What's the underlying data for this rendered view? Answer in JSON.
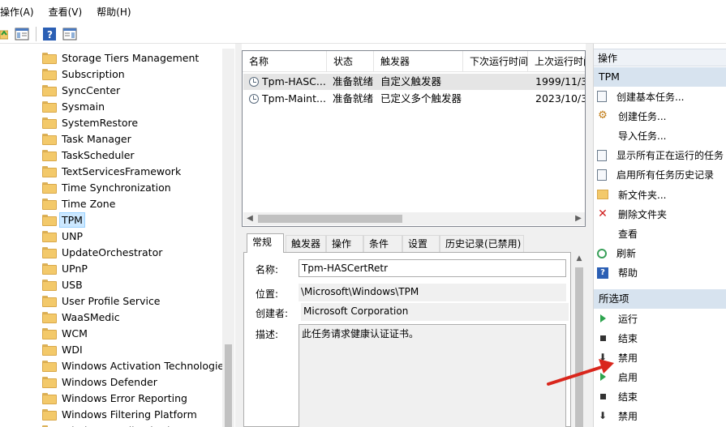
{
  "menu": [
    "操作(A)",
    "查看(V)",
    "帮助(H)"
  ],
  "toolbar": {
    "buttons": [
      "folder-up-icon",
      "show-hide-tree-icon",
      "help-icon",
      "action-pane-icon"
    ]
  },
  "tree": {
    "items": [
      "Storage Tiers Management",
      "Subscription",
      "SyncCenter",
      "Sysmain",
      "SystemRestore",
      "Task Manager",
      "TaskScheduler",
      "TextServicesFramework",
      "Time Synchronization",
      "Time Zone",
      "TPM",
      "UNP",
      "UpdateOrchestrator",
      "UPnP",
      "USB",
      "User Profile Service",
      "WaaSMedic",
      "WCM",
      "WDI",
      "Windows Activation Technologies",
      "Windows Defender",
      "Windows Error Reporting",
      "Windows Filtering Platform",
      "Windows Media Sharing"
    ],
    "selected": "TPM"
  },
  "tasklist": {
    "columns": [
      "名称",
      "状态",
      "触发器",
      "下次运行时间",
      "上次运行时间"
    ],
    "rows": [
      {
        "name": "Tpm-HASC...",
        "status": "准备就绪",
        "trigger": "自定义触发器",
        "next": "",
        "last": "1999/11/3"
      },
      {
        "name": "Tpm-Maint...",
        "status": "准备就绪",
        "trigger": "已定义多个触发器",
        "next": "",
        "last": "2023/10/3"
      }
    ]
  },
  "detail": {
    "tabs": [
      "常规",
      "触发器",
      "操作",
      "条件",
      "设置",
      "历史记录(已禁用)"
    ],
    "fields": {
      "name_label": "名称:",
      "name_value": "Tpm-HASCertRetr",
      "location_label": "位置:",
      "location_value": "\\Microsoft\\Windows\\TPM",
      "author_label": "创建者:",
      "author_value": "Microsoft Corporation",
      "desc_label": "描述:",
      "desc_value": "此任务请求健康认证证书。"
    }
  },
  "actions": {
    "header": "操作",
    "group1_title": "TPM",
    "group1": [
      {
        "label": "创建基本任务...",
        "icon": "create-basic-task-icon"
      },
      {
        "label": "创建任务...",
        "icon": "create-task-icon"
      },
      {
        "label": "导入任务...",
        "icon": "none"
      },
      {
        "label": "显示所有正在运行的任务",
        "icon": "running-tasks-icon"
      },
      {
        "label": "启用所有任务历史记录",
        "icon": "history-icon"
      },
      {
        "label": "新文件夹...",
        "icon": "new-folder-icon"
      },
      {
        "label": "删除文件夹",
        "icon": "delete-icon"
      },
      {
        "label": "查看",
        "icon": "none"
      },
      {
        "label": "刷新",
        "icon": "refresh-icon"
      },
      {
        "label": "帮助",
        "icon": "help-icon"
      }
    ],
    "group2_title": "所选项",
    "group2": [
      {
        "label": "运行",
        "icon": "run-icon"
      },
      {
        "label": "结束",
        "icon": "end-icon"
      },
      {
        "label": "禁用",
        "icon": "disable-icon"
      },
      {
        "label": "启用",
        "icon": "run-icon"
      },
      {
        "label": "结束",
        "icon": "end-icon"
      },
      {
        "label": "禁用",
        "icon": "disable-icon"
      }
    ]
  },
  "colors": {
    "selection": "#cce8ff",
    "action_header": "#d7e3ef",
    "annotation_arrow": "#d9261c"
  }
}
